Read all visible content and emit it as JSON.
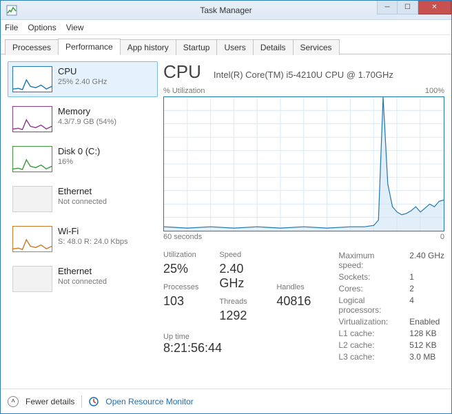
{
  "window": {
    "title": "Task Manager"
  },
  "menu": {
    "file": "File",
    "options": "Options",
    "view": "View"
  },
  "tabs": {
    "processes": "Processes",
    "performance": "Performance",
    "app_history": "App history",
    "startup": "Startup",
    "users": "Users",
    "details": "Details",
    "services": "Services"
  },
  "sidebar": [
    {
      "name": "CPU",
      "sub": "25% 2.40 GHz",
      "color": "#1f77b4",
      "selected": true
    },
    {
      "name": "Memory",
      "sub": "4.3/7.9 GB (54%)",
      "color": "#8e3b8e",
      "selected": false
    },
    {
      "name": "Disk 0 (C:)",
      "sub": "16%",
      "color": "#3c9a3c",
      "selected": false
    },
    {
      "name": "Ethernet",
      "sub": "Not connected",
      "color": "#d0d0d0",
      "selected": false,
      "dead": true
    },
    {
      "name": "Wi-Fi",
      "sub": "S: 48.0 R: 24.0 Kbps",
      "color": "#cc7a29",
      "selected": false
    },
    {
      "name": "Ethernet",
      "sub": "Not connected",
      "color": "#d0d0d0",
      "selected": false,
      "dead": true
    }
  ],
  "main": {
    "heading": "CPU",
    "description": "Intel(R) Core(TM) i5-4210U CPU @ 1.70GHz",
    "chart_top_left": "% Utilization",
    "chart_top_right": "100%",
    "chart_bottom_left": "60 seconds",
    "chart_bottom_right": "0",
    "stats": {
      "utilization_label": "Utilization",
      "utilization": "25%",
      "speed_label": "Speed",
      "speed": "2.40 GHz",
      "processes_label": "Processes",
      "processes": "103",
      "threads_label": "Threads",
      "threads": "1292",
      "handles_label": "Handles",
      "handles": "40816",
      "uptime_label": "Up time",
      "uptime": "8:21:56:44"
    },
    "info": {
      "max_speed_label": "Maximum speed:",
      "max_speed": "2.40 GHz",
      "sockets_label": "Sockets:",
      "sockets": "1",
      "cores_label": "Cores:",
      "cores": "2",
      "logical_label": "Logical processors:",
      "logical": "4",
      "virt_label": "Virtualization:",
      "virt": "Enabled",
      "l1_label": "L1 cache:",
      "l1": "128 KB",
      "l2_label": "L2 cache:",
      "l2": "512 KB",
      "l3_label": "L3 cache:",
      "l3": "3.0 MB"
    }
  },
  "footer": {
    "fewer": "Fewer details",
    "resource_monitor": "Open Resource Monitor"
  },
  "chart_data": {
    "type": "line",
    "title": "% Utilization",
    "xlabel": "seconds ago",
    "ylabel": "% Utilization",
    "xlim": [
      60,
      0
    ],
    "ylim": [
      0,
      100
    ],
    "x": [
      60,
      55,
      50,
      45,
      40,
      35,
      30,
      25,
      20,
      17,
      15,
      14,
      13,
      12,
      11,
      10,
      9,
      8,
      7,
      6,
      5,
      4,
      3,
      2,
      1,
      0
    ],
    "values": [
      3,
      2,
      3,
      2,
      3,
      2,
      3,
      2,
      3,
      3,
      4,
      8,
      100,
      35,
      18,
      14,
      12,
      13,
      15,
      18,
      14,
      17,
      20,
      18,
      22,
      23
    ]
  }
}
